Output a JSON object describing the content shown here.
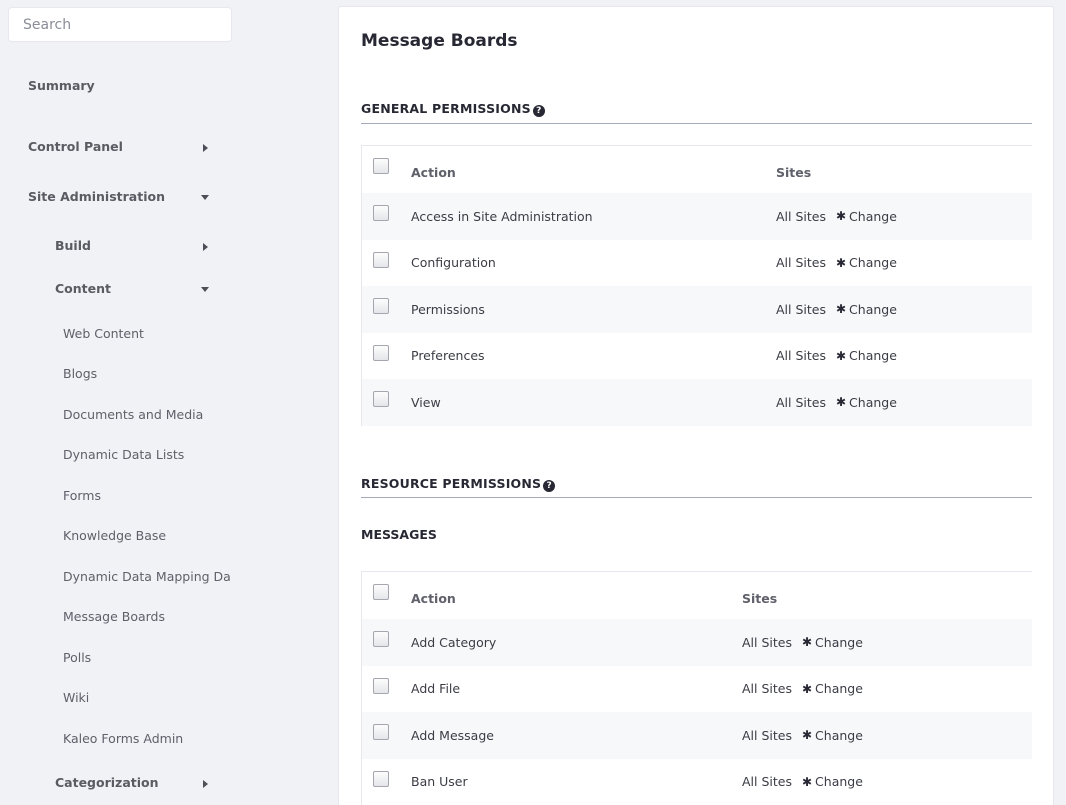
{
  "sidebar": {
    "search": {
      "placeholder": "Search",
      "value": ""
    },
    "summary": "Summary",
    "control_panel": "Control Panel",
    "site_admin": "Site Administration",
    "build": "Build",
    "content": "Content",
    "content_items": [
      "Web Content",
      "Blogs",
      "Documents and Media",
      "Dynamic Data Lists",
      "Forms",
      "Knowledge Base",
      "Dynamic Data Mapping Data P",
      "Message Boards",
      "Polls",
      "Wiki",
      "Kaleo Forms Admin"
    ],
    "categorization": "Categorization"
  },
  "main": {
    "title": "Message Boards",
    "general": {
      "title": "GENERAL PERMISSIONS",
      "help_icon": "?",
      "col_action": "Action",
      "col_sites": "Sites",
      "rows": [
        {
          "action": "Access in Site Administration",
          "sites": "All Sites",
          "change": "Change"
        },
        {
          "action": "Configuration",
          "sites": "All Sites",
          "change": "Change"
        },
        {
          "action": "Permissions",
          "sites": "All Sites",
          "change": "Change"
        },
        {
          "action": "Preferences",
          "sites": "All Sites",
          "change": "Change"
        },
        {
          "action": "View",
          "sites": "All Sites",
          "change": "Change"
        }
      ]
    },
    "resource": {
      "title": "RESOURCE PERMISSIONS",
      "help_icon": "?",
      "subsection": "MESSAGES",
      "col_action": "Action",
      "col_sites": "Sites",
      "rows": [
        {
          "action": "Add Category",
          "sites": "All Sites",
          "change": "Change"
        },
        {
          "action": "Add File",
          "sites": "All Sites",
          "change": "Change"
        },
        {
          "action": "Add Message",
          "sites": "All Sites",
          "change": "Change"
        },
        {
          "action": "Ban User",
          "sites": "All Sites",
          "change": "Change"
        }
      ]
    }
  }
}
